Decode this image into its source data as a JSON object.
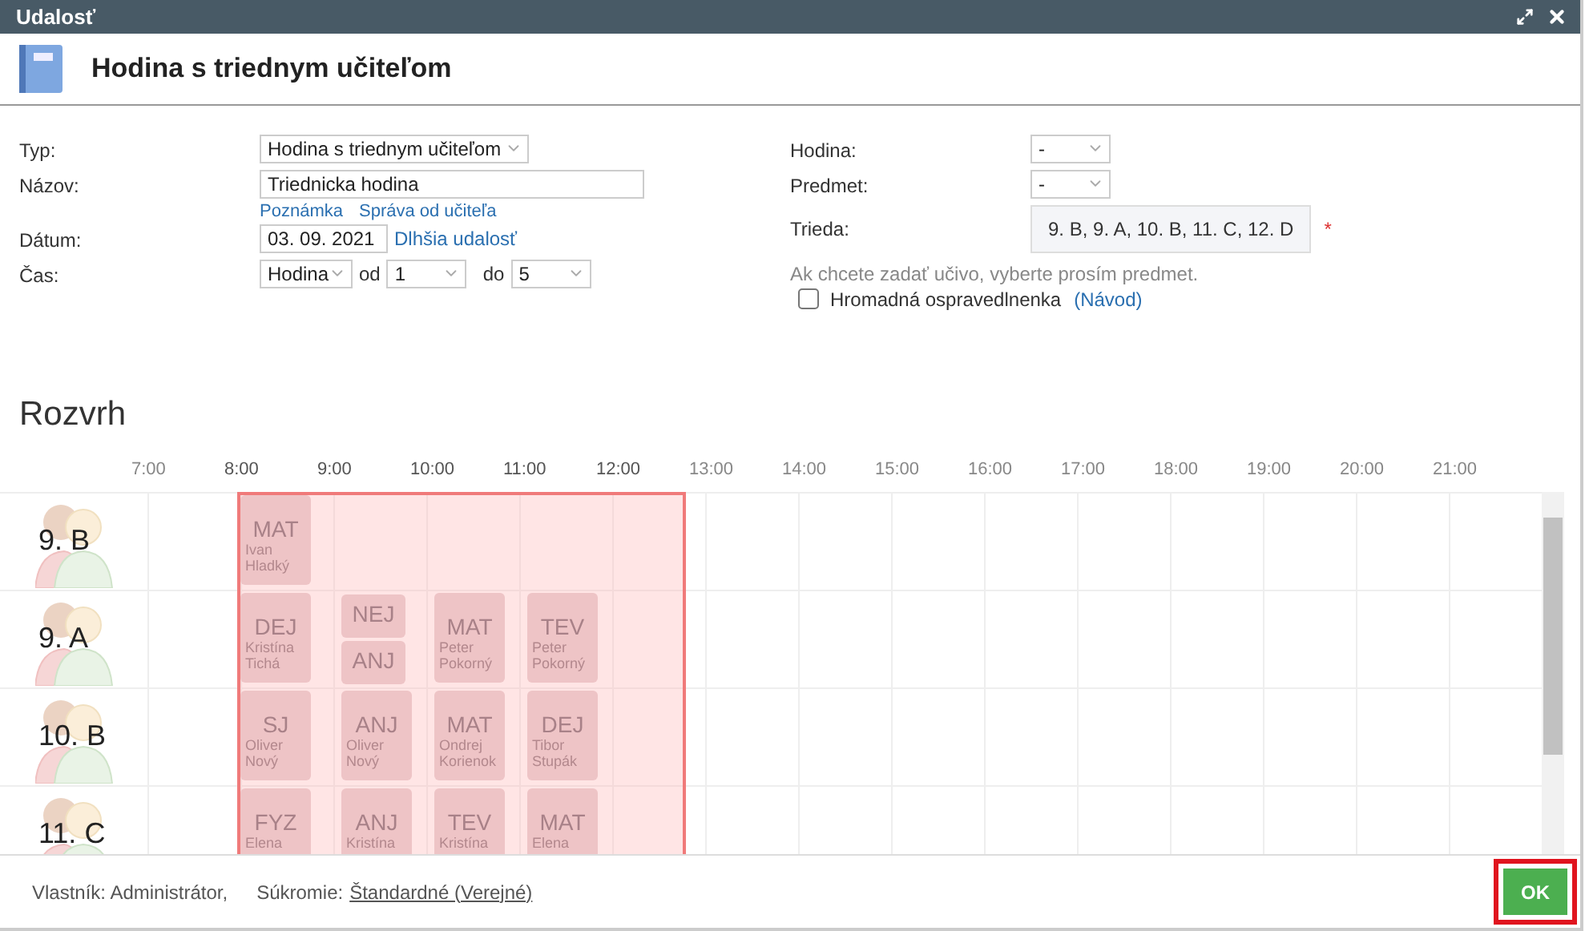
{
  "window": {
    "title": "Udalosť"
  },
  "header": {
    "title": "Hodina s triednym učiteľom"
  },
  "form": {
    "left": [
      {
        "kind": "select",
        "label": "Typ:",
        "value": "Hodina s triednym učiteľom"
      },
      {
        "kind": "text",
        "label": "Názov:",
        "value": "Triednicka hodina",
        "links": [
          "Poznámka",
          "Správa od učiteľa"
        ]
      },
      {
        "kind": "date",
        "label": "Dátum:",
        "value": "03. 09. 2021",
        "link": "Dlhšia udalosť"
      },
      {
        "kind": "time",
        "label": "Čas:",
        "unit": "Hodina",
        "from_label": "od",
        "from": "1",
        "to_label": "do",
        "to": "5"
      }
    ],
    "right": [
      {
        "kind": "select",
        "label": "Hodina:",
        "value": "-"
      },
      {
        "kind": "select",
        "label": "Predmet:",
        "value": "-"
      },
      {
        "kind": "classes",
        "label": "Trieda:",
        "value": "9. B, 9. A, 10. B, 11. C, 12. D",
        "required_mark": "*"
      }
    ],
    "hint": "Ak chcete zadať učivo, vyberte prosím predmet.",
    "bulk_excuse": {
      "label": "Hromadná ospravedlnenka",
      "checked": false,
      "link": "(Návod)"
    }
  },
  "timetable": {
    "title": "Rozvrh",
    "hours": [
      {
        "label": "7:00",
        "selected": false
      },
      {
        "label": "8:00",
        "selected": true
      },
      {
        "label": "9:00",
        "selected": true
      },
      {
        "label": "10:00",
        "selected": true
      },
      {
        "label": "11:00",
        "selected": true
      },
      {
        "label": "12:00",
        "selected": true
      },
      {
        "label": "13:00",
        "selected": false
      },
      {
        "label": "14:00",
        "selected": false
      },
      {
        "label": "15:00",
        "selected": false
      },
      {
        "label": "16:00",
        "selected": false
      },
      {
        "label": "17:00",
        "selected": false
      },
      {
        "label": "18:00",
        "selected": false
      },
      {
        "label": "19:00",
        "selected": false
      },
      {
        "label": "20:00",
        "selected": false
      },
      {
        "label": "21:00",
        "selected": false
      }
    ],
    "rows": [
      {
        "class": "9. B",
        "lessons": [
          {
            "kind": "single",
            "subject": "MAT",
            "teacher": "Ivan Hladký"
          },
          {
            "kind": "empty"
          },
          {
            "kind": "empty"
          },
          {
            "kind": "empty"
          }
        ]
      },
      {
        "class": "9. A",
        "lessons": [
          {
            "kind": "single",
            "subject": "DEJ",
            "teacher": "Kristína Tichá"
          },
          {
            "kind": "split",
            "subjects": [
              "NEJ",
              "ANJ"
            ]
          },
          {
            "kind": "single",
            "subject": "MAT",
            "teacher": "Peter Pokorný"
          },
          {
            "kind": "single",
            "subject": "TEV",
            "teacher": "Peter Pokorný"
          }
        ]
      },
      {
        "class": "10. B",
        "lessons": [
          {
            "kind": "single",
            "subject": "SJ",
            "teacher": "Oliver Nový"
          },
          {
            "kind": "single",
            "subject": "ANJ",
            "teacher": "Oliver Nový"
          },
          {
            "kind": "single",
            "subject": "MAT",
            "teacher": "Ondrej Korienok"
          },
          {
            "kind": "single",
            "subject": "DEJ",
            "teacher": "Tibor Stupák"
          }
        ]
      },
      {
        "class": "11. C",
        "lessons": [
          {
            "kind": "single",
            "subject": "FYZ",
            "teacher": "Elena"
          },
          {
            "kind": "single",
            "subject": "ANJ",
            "teacher": "Kristína"
          },
          {
            "kind": "single",
            "subject": "TEV",
            "teacher": "Kristína"
          },
          {
            "kind": "single",
            "subject": "MAT",
            "teacher": "Elena"
          }
        ]
      }
    ]
  },
  "footer": {
    "owner": "Vlastník: Administrátor,",
    "privacy_label": "Súkromie:",
    "privacy": "Štandardné (Verejné)",
    "ok": "OK"
  }
}
